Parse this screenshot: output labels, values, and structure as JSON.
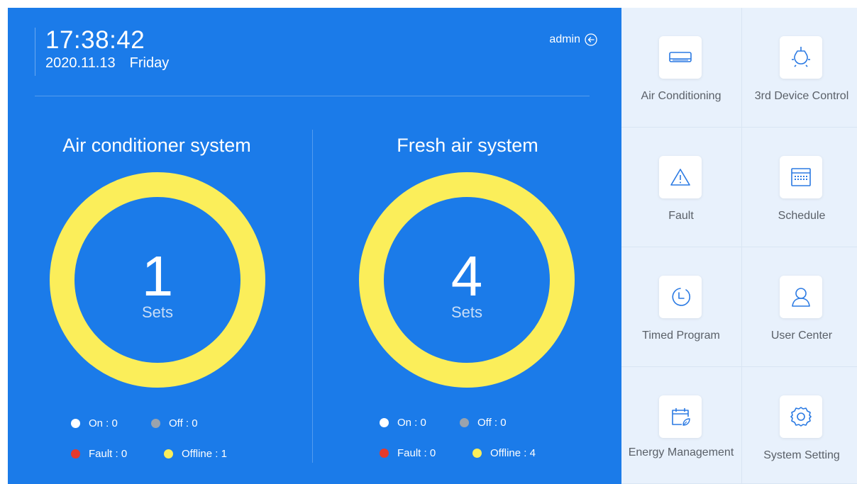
{
  "header": {
    "time": "17:38:42",
    "date": "2020.11.13",
    "weekday": "Friday",
    "user": "admin"
  },
  "systems": [
    {
      "title": "Air conditioner system",
      "count": "1",
      "unit": "Sets",
      "legend": {
        "on": "On : 0",
        "off": "Off : 0",
        "fault": "Fault : 0",
        "offline": "Offline : 1"
      }
    },
    {
      "title": "Fresh air system",
      "count": "4",
      "unit": "Sets",
      "legend": {
        "on": "On : 0",
        "off": "Off : 0",
        "fault": "Fault : 0",
        "offline": "Offline : 4"
      }
    }
  ],
  "menu": [
    {
      "label": "Air Conditioning",
      "icon": "air-conditioner-icon"
    },
    {
      "label": "3rd Device Control",
      "icon": "light-bulb-icon"
    },
    {
      "label": "Fault",
      "icon": "warning-icon"
    },
    {
      "label": "Schedule",
      "icon": "calendar-icon"
    },
    {
      "label": "Timed Program",
      "icon": "clock-icon"
    },
    {
      "label": "User Center",
      "icon": "user-icon"
    },
    {
      "label": "Energy Management",
      "icon": "energy-calendar-icon"
    },
    {
      "label": "System Setting",
      "icon": "gear-icon"
    }
  ],
  "colors": {
    "panel_blue": "#1b7be9",
    "ring_yellow": "#fbee5a",
    "on": "#ffffff",
    "off": "#9aa3ad",
    "fault": "#e53a2c",
    "offline": "#fbee5a",
    "icon_blue": "#2b7ae3"
  }
}
